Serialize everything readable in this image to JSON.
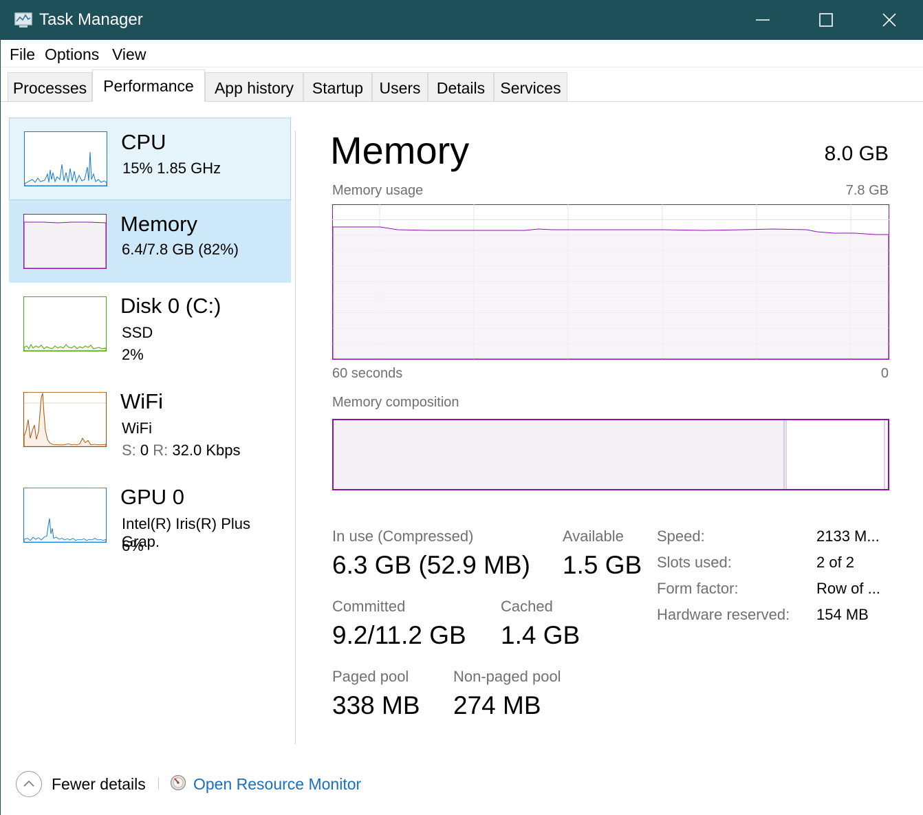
{
  "window": {
    "title": "Task Manager",
    "icons": [
      "task-manager-icon",
      "minimize-icon",
      "maximize-icon",
      "close-icon"
    ]
  },
  "menu": {
    "file": "File",
    "options": "Options",
    "view": "View"
  },
  "tabs": [
    {
      "label": "Processes"
    },
    {
      "label": "Performance",
      "active": true
    },
    {
      "label": "App history"
    },
    {
      "label": "Startup"
    },
    {
      "label": "Users"
    },
    {
      "label": "Details"
    },
    {
      "label": "Services"
    }
  ],
  "sidebar": {
    "items": [
      {
        "name": "CPU",
        "line1": "15%  1.85 GHz",
        "color": "#1979ca"
      },
      {
        "name": "Memory",
        "line1": "6.4/7.8 GB (82%)",
        "color": "#8b12ae"
      },
      {
        "name": "Disk 0 (C:)",
        "line1": "SSD",
        "line2": "2%",
        "color": "#4da60c"
      },
      {
        "name": "WiFi",
        "line1": "WiFi",
        "send_label": "S:",
        "send_value": "0",
        "recv_label": "R:",
        "recv_value": "32.0 Kbps",
        "color": "#a74f01"
      },
      {
        "name": "GPU 0",
        "line1": "Intel(R) Iris(R) Plus Grap.",
        "line2": "6%",
        "color": "#1979ca"
      }
    ]
  },
  "main": {
    "title": "Memory",
    "total": "8.0 GB",
    "usage_label": "Memory usage",
    "usage_max": "7.8 GB",
    "time_left": "60 seconds",
    "time_right": "0",
    "composition_label": "Memory composition",
    "accent_color": "#8b12ae",
    "usage_fraction": 0.86,
    "stats": {
      "in_use_label": "In use (Compressed)",
      "in_use_value": "6.3 GB (52.9 MB)",
      "available_label": "Available",
      "available_value": "1.5 GB",
      "committed_label": "Committed",
      "committed_value": "9.2/11.2 GB",
      "cached_label": "Cached",
      "cached_value": "1.4 GB",
      "paged_label": "Paged pool",
      "paged_value": "338 MB",
      "nonpaged_label": "Non-paged pool",
      "nonpaged_value": "274 MB"
    },
    "specs": {
      "speed_label": "Speed:",
      "speed_value": "2133 M...",
      "slots_label": "Slots used:",
      "slots_value": "2 of 2",
      "form_label": "Form factor:",
      "form_value": "Row of ...",
      "hw_label": "Hardware reserved:",
      "hw_value": "154 MB"
    }
  },
  "footer": {
    "fewer_details": "Fewer details",
    "open_resource_monitor": "Open Resource Monitor"
  }
}
